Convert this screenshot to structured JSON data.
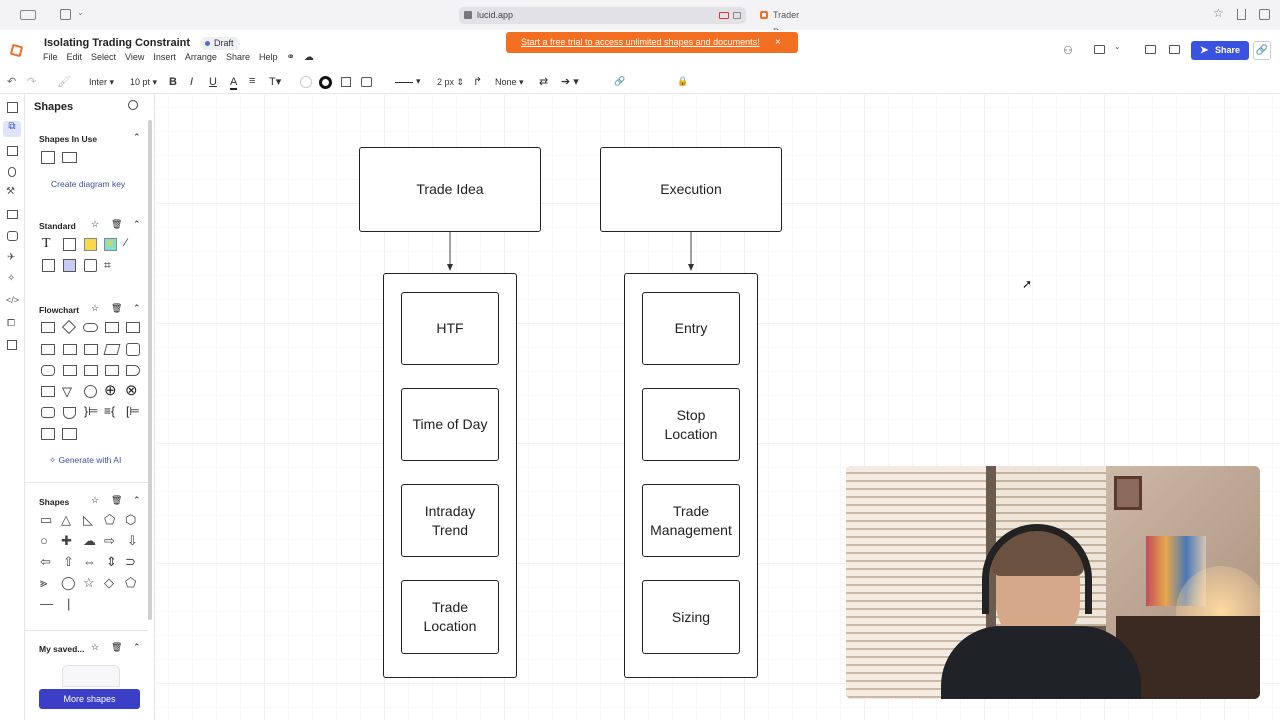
{
  "browser": {
    "url": "lucid.app",
    "tab2": "Trader Progress..."
  },
  "app": {
    "doc_title": "Isolating Trading Constraint",
    "status": "Draft",
    "menu": [
      "File",
      "Edit",
      "Select",
      "View",
      "Insert",
      "Arrange",
      "Share",
      "Help"
    ],
    "banner": "Start a free trial to access unlimited shapes and documents!",
    "share_label": "Share"
  },
  "toolbar": {
    "font": "Inter",
    "font_size": "10 pt",
    "bold": "B",
    "italic": "I",
    "underline": "U",
    "color": "A",
    "stroke_width": "2 px",
    "arrow_none": "None"
  },
  "panel": {
    "title": "Shapes",
    "in_use": "Shapes In Use",
    "create_key": "Create diagram key",
    "standard": "Standard",
    "flowchart": "Flowchart",
    "generate_ai": "Generate with AI",
    "shapes": "Shapes",
    "my_saved": "My saved...",
    "more_shapes": "More shapes"
  },
  "diagram": {
    "trade_idea": "Trade Idea",
    "execution": "Execution",
    "left_items": [
      "HTF",
      "Time of Day",
      "Intraday Trend",
      "Trade Location"
    ],
    "right_items": [
      "Entry",
      "Stop Location",
      "Trade Management",
      "Sizing"
    ]
  }
}
